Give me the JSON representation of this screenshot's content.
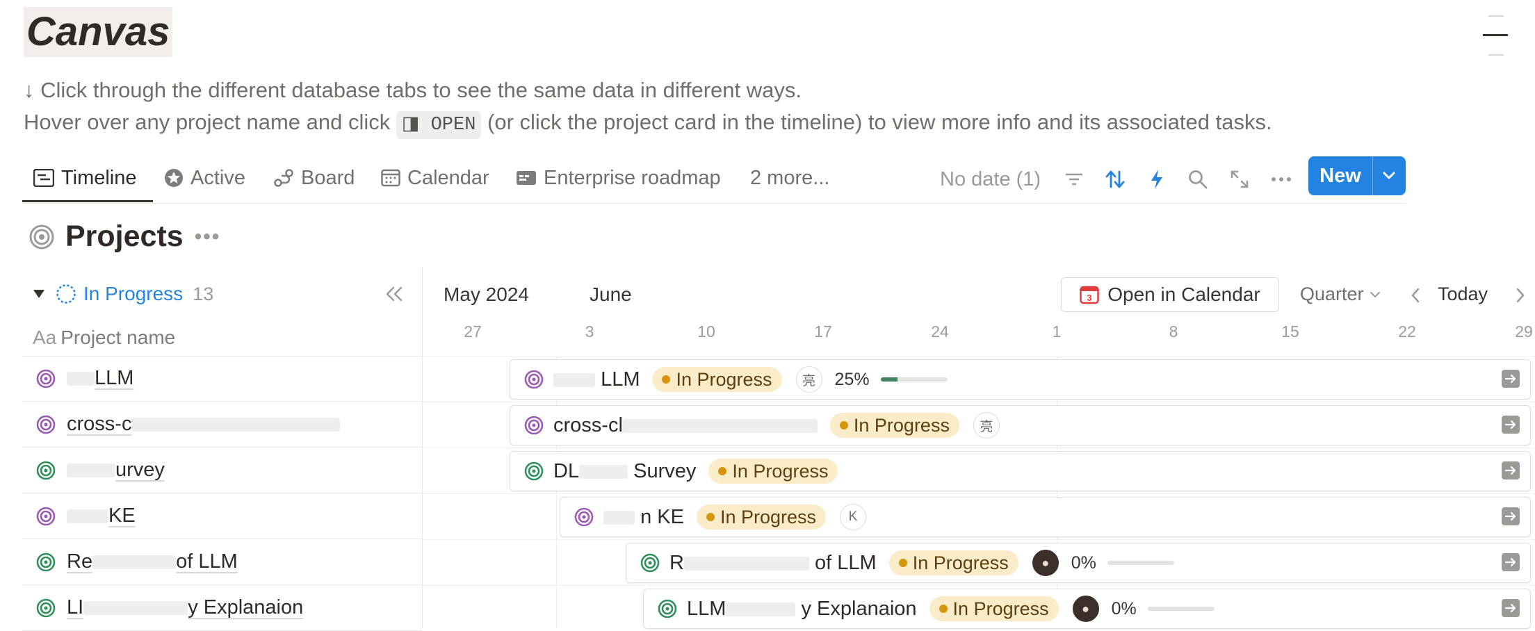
{
  "page": {
    "title": "Canvas",
    "desc_line1": "↓ Click through the different database tabs to see the same data in different ways.",
    "desc_line2_prefix": "Hover over any project name and click",
    "open_chip": "◨ OPEN",
    "desc_line2_suffix": "(or click the project card in the timeline) to view more info and its associated tasks."
  },
  "tabs": [
    {
      "label": "Timeline",
      "icon": "timeline-icon",
      "active": true
    },
    {
      "label": "Active",
      "icon": "star-icon"
    },
    {
      "label": "Board",
      "icon": "board-icon"
    },
    {
      "label": "Calendar",
      "icon": "calendar-icon"
    },
    {
      "label": "Enterprise roadmap",
      "icon": "roadmap-icon"
    },
    {
      "label": "2 more..."
    }
  ],
  "toolbar": {
    "no_date": "No date (1)",
    "new_label": "New",
    "accent": "#2383e2"
  },
  "section": {
    "title": "Projects"
  },
  "group": {
    "label": "In Progress",
    "count": "13"
  },
  "columns": {
    "name_prefix": "Aa",
    "name": "Project name"
  },
  "projects": [
    {
      "name_left": "",
      "name_right": "LLM",
      "icon_color": "#9b59b6"
    },
    {
      "name_left": "cross-c",
      "name_right": "",
      "icon_color": "#9b59b6"
    },
    {
      "name_left": "",
      "name_right": "urvey",
      "icon_color": "#2f8f5b"
    },
    {
      "name_left": "",
      "name_right": "KE",
      "icon_color": "#9b59b6"
    },
    {
      "name_left": "Re",
      "name_right": "of LLM",
      "icon_color": "#2f8f5b"
    },
    {
      "name_left": "LI",
      "name_right": "y Explanaion",
      "icon_color": "#2f8f5b"
    }
  ],
  "timeline": {
    "months": [
      "May 2024",
      "June"
    ],
    "open_in_calendar": "Open in Calendar",
    "calendar_badge": "3",
    "scale": "Quarter",
    "today": "Today",
    "days": [
      "27",
      "3",
      "10",
      "17",
      "24",
      "1",
      "8",
      "15",
      "22",
      "29"
    ],
    "status_label": "In Progress",
    "cards": [
      {
        "name_left": "",
        "name_right": "LLM",
        "avatar": "亮",
        "percent": "25%",
        "progress": 0.25,
        "icon_color": "#9b59b6"
      },
      {
        "name_left": "cross-cl",
        "name_right": "",
        "avatar": "亮",
        "icon_color": "#9b59b6"
      },
      {
        "name_left": "DL",
        "name_right": "Survey",
        "icon_color": "#2f8f5b"
      },
      {
        "name_left": "",
        "name_right": "n KE",
        "avatar": "K",
        "icon_color": "#9b59b6"
      },
      {
        "name_left": "R",
        "name_right": "of LLM",
        "avatar": "photo",
        "percent": "0%",
        "progress": 0,
        "icon_color": "#2f8f5b"
      },
      {
        "name_left": "LLM",
        "name_right": "y Explanaion",
        "avatar": "photo",
        "percent": "0%",
        "progress": 0,
        "icon_color": "#2f8f5b"
      }
    ]
  }
}
